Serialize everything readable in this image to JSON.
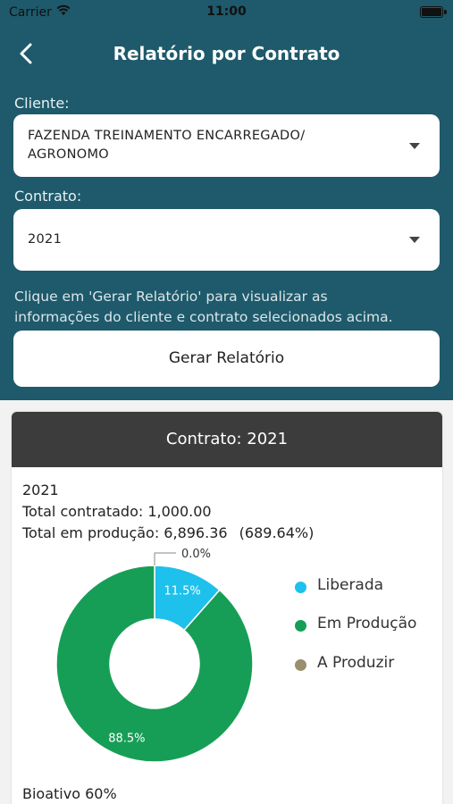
{
  "status_bar": {
    "carrier": "Carrier",
    "time": "11:00"
  },
  "nav": {
    "title": "Relatório por Contrato",
    "back_icon": "chevron-left-icon"
  },
  "form": {
    "cliente_label": "Cliente:",
    "cliente_line1": "FAZENDA TREINAMENTO ENCARREGADO/",
    "cliente_line2": "AGRONOMO",
    "contrato_label": "Contrato:",
    "contrato_value": "2021",
    "hint_line1": "Clique em 'Gerar Relatório' para visualizar as",
    "hint_line2": "informações do cliente e contrato selecionados acima.",
    "button_label": "Gerar Relatório"
  },
  "card": {
    "header": "Contrato: 2021",
    "year": "2021",
    "total_contratado": "Total contratado: 1,000.00",
    "total_producao": "Total em produção: 6,896.36",
    "total_producao_pct": "(689.64%)",
    "footer_label": "Bioativo 60%"
  },
  "chart_data": {
    "type": "pie",
    "donut": true,
    "labels": [
      "Liberada",
      "Em Produção",
      "A Produzir"
    ],
    "values": [
      11.5,
      88.5,
      0.0
    ],
    "value_labels": [
      "11.5%",
      "88.5%",
      "0.0%"
    ],
    "colors": [
      "#1ec0ec",
      "#179e56",
      "#9b8e6c"
    ],
    "legend_position": "right"
  }
}
